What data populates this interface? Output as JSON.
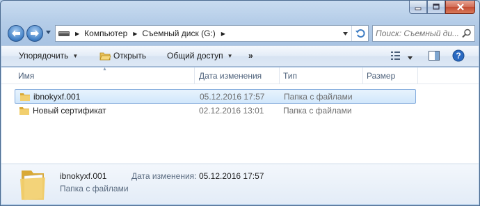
{
  "window": {
    "caption_buttons": [
      "minimize-icon",
      "maximize-icon",
      "close-icon"
    ]
  },
  "address": {
    "crumbs": [
      "Компьютер",
      "Съемный диск (G:)"
    ],
    "drive_icon": "removable-drive-icon"
  },
  "search": {
    "placeholder": "Поиск: Съемный ди..."
  },
  "toolbar": {
    "organize": "Упорядочить",
    "open": "Открыть",
    "share": "Общий доступ",
    "more": "»"
  },
  "columns": {
    "name": "Имя",
    "date": "Дата изменения",
    "type": "Тип",
    "size": "Размер"
  },
  "files": [
    {
      "name": "ibnokyxf.001",
      "date": "05.12.2016 17:57",
      "type": "Папка с файлами",
      "selected": true
    },
    {
      "name": "Новый сертификат",
      "date": "02.12.2016 13:01",
      "type": "Папка с файлами",
      "selected": false
    }
  ],
  "details": {
    "name": "ibnokyxf.001",
    "type": "Папка с файлами",
    "date_label": "Дата изменения:",
    "date": "05.12.2016 17:57"
  },
  "colors": {
    "folder": "#e8c15a",
    "selection": "#d1e7fb",
    "accent": "#3f7ec4"
  }
}
